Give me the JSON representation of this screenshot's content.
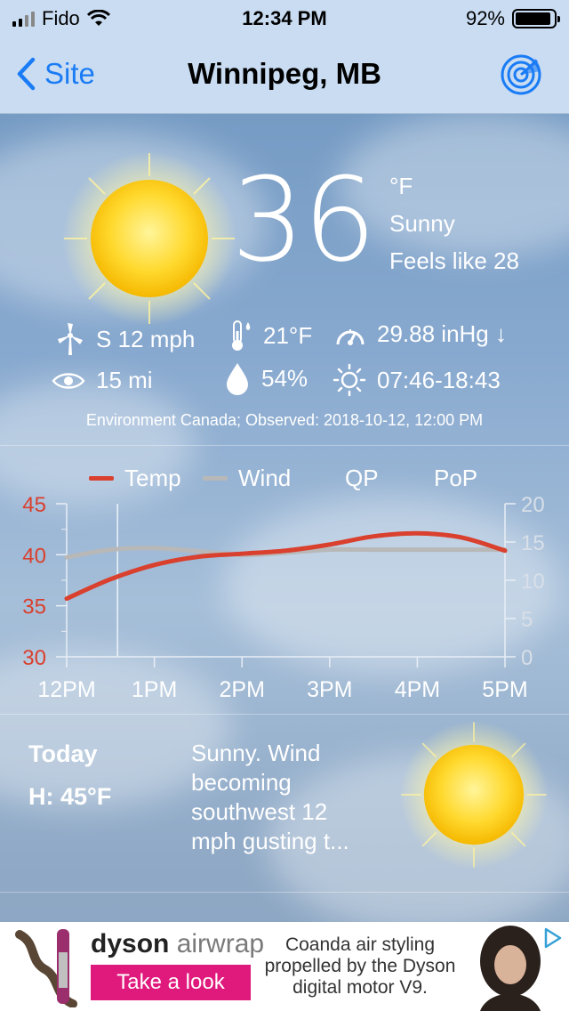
{
  "status_bar": {
    "carrier": "Fido",
    "time": "12:34 PM",
    "battery": "92%"
  },
  "nav": {
    "back_label": "Site",
    "title": "Winnipeg, MB"
  },
  "current": {
    "temperature": "36",
    "unit": "°F",
    "condition": "Sunny",
    "feels_like": "Feels like 28",
    "wind": "S 12 mph",
    "dewpoint": "21°F",
    "pressure": "29.88 inHg ↓",
    "visibility": "15 mi",
    "humidity": "54%",
    "sun_times": "07:46-18:43",
    "observed": "Environment Canada; Observed: 2018-10-12, 12:00 PM"
  },
  "legend": {
    "temp": "Temp",
    "wind": "Wind",
    "qp": "QP",
    "pop": "PoP"
  },
  "colors": {
    "temp": "#d9402e",
    "wind": "#b8b8b8",
    "accent": "#1a7cf5",
    "ad_pink": "#e0197c"
  },
  "chart_data": {
    "type": "line",
    "x": [
      "12PM",
      "1PM",
      "2PM",
      "3PM",
      "4PM",
      "5PM"
    ],
    "y_left_ticks": [
      "45",
      "40",
      "35",
      "30"
    ],
    "y_right_ticks": [
      "20",
      "15",
      "10",
      "5",
      "0"
    ],
    "ylim_left": [
      30,
      45
    ],
    "ylim_right": [
      0,
      20
    ],
    "now_marker_hours": 0.58,
    "series": [
      {
        "name": "Temp",
        "axis": "left",
        "hours": [
          0,
          0.5,
          1,
          1.5,
          2,
          2.5,
          3,
          3.5,
          4,
          4.5,
          5
        ],
        "values": [
          35.7,
          37.6,
          39,
          39.8,
          40.1,
          40.4,
          41,
          41.8,
          42.1,
          41.7,
          40.4
        ]
      },
      {
        "name": "Wind",
        "axis": "right",
        "hours": [
          0,
          0.5,
          1,
          1.5,
          2,
          2.5,
          3,
          3.5,
          4,
          4.5,
          5
        ],
        "values": [
          13,
          14,
          14.2,
          13.8,
          13.3,
          13.6,
          14,
          14,
          14,
          14,
          14
        ]
      }
    ]
  },
  "today": {
    "label": "Today",
    "high": "H: 45°F",
    "summary": "Sunny. Wind becoming southwest 12 mph gusting t..."
  },
  "ad": {
    "brand": "dyson",
    "product": "airwrap",
    "cta": "Take a look",
    "copy": "Coanda air styling propelled by the Dyson digital motor V9."
  }
}
